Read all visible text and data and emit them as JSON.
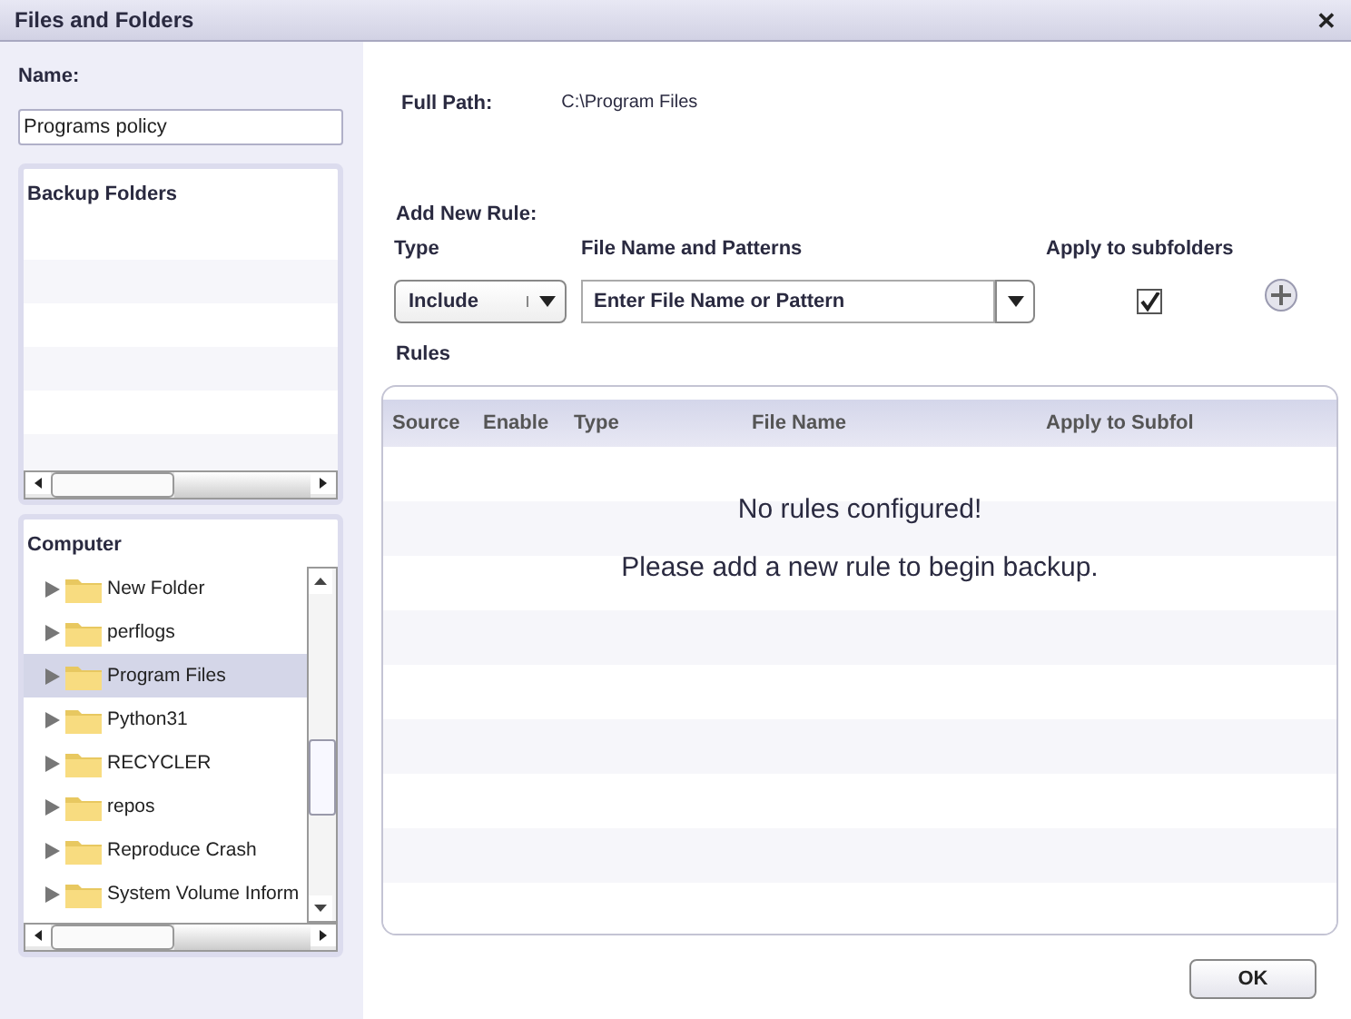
{
  "window": {
    "title": "Files and Folders",
    "close": "✕"
  },
  "name_field": {
    "label": "Name:",
    "value": "Programs policy"
  },
  "backup_folders": {
    "title": "Backup Folders"
  },
  "computer": {
    "title": "Computer",
    "items": [
      {
        "label": "New Folder",
        "selected": false
      },
      {
        "label": "perflogs",
        "selected": false
      },
      {
        "label": "Program Files",
        "selected": true
      },
      {
        "label": "Python31",
        "selected": false
      },
      {
        "label": "RECYCLER",
        "selected": false
      },
      {
        "label": "repos",
        "selected": false
      },
      {
        "label": "Reproduce Crash",
        "selected": false
      },
      {
        "label": "System Volume Inform",
        "selected": false
      }
    ]
  },
  "full_path": {
    "label": "Full Path:",
    "value": "C:\\Program Files"
  },
  "add_rule": {
    "title": "Add New Rule:",
    "type_label": "Type",
    "type_value": "Include",
    "pattern_label": "File Name and Patterns",
    "pattern_placeholder": "Enter File Name or Pattern",
    "subfolders_label": "Apply to subfolders",
    "subfolders_checked": true
  },
  "rules": {
    "title": "Rules",
    "columns": [
      "Source",
      "Enable",
      "Type",
      "File Name",
      "Apply to Subfol"
    ],
    "empty_title": "No rules configured!",
    "empty_message": "Please add a new rule to begin backup."
  },
  "buttons": [
    "OK"
  ]
}
